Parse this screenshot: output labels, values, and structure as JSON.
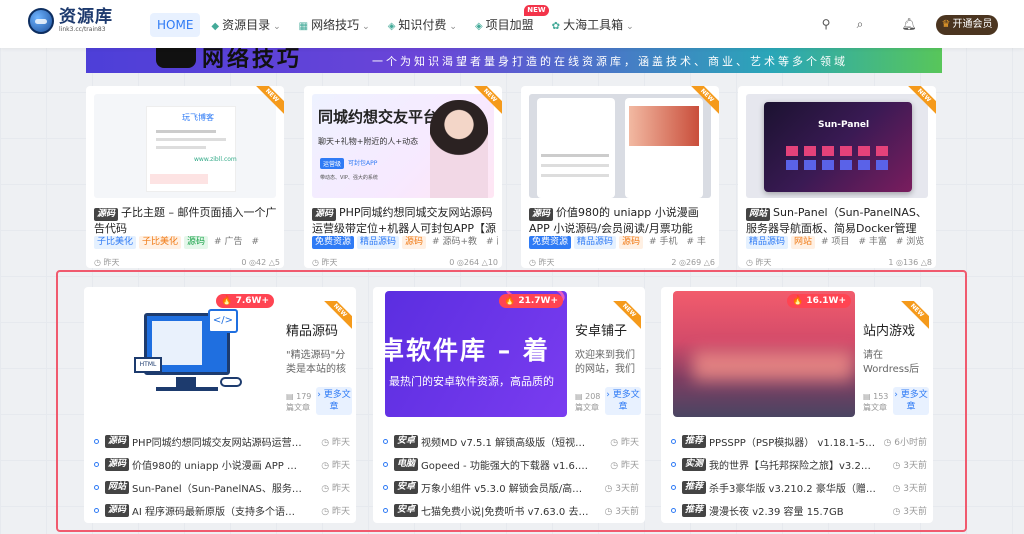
{
  "header": {
    "logo_title": "资源库",
    "logo_sub": "link3.cc/train83",
    "nav": [
      {
        "label": "HOME",
        "icon": "",
        "caret": false,
        "active": true
      },
      {
        "label": "资源目录",
        "icon": "◆",
        "caret": true
      },
      {
        "label": "网络技巧",
        "icon": "▦",
        "caret": true
      },
      {
        "label": "知识付费",
        "icon": "◈",
        "caret": true
      },
      {
        "label": "项目加盟",
        "icon": "◈",
        "caret": false,
        "badge": "NEW"
      },
      {
        "label": "大海工具箱",
        "icon": "✿",
        "caret": true
      }
    ],
    "vip_label": "开通会员"
  },
  "banner": {
    "title": "网络技巧",
    "slogan": "一个为知识渴望者量身打造的在线资源库，涵盖技术、商业、艺术等多个领域"
  },
  "top_cards": [
    {
      "new": "NEW",
      "cat": "源码",
      "title": "子比主题 – 邮件页面插入一个广告代码",
      "tags": [
        {
          "t": "子比美化",
          "c": "tg-blue"
        },
        {
          "t": "子比美化",
          "c": "tg-orange"
        },
        {
          "t": "源码",
          "c": "tg-green"
        },
        {
          "t": "# 广告",
          "c": "tg-grey"
        },
        {
          "t": "#",
          "c": "tg-grey"
        }
      ],
      "time": "昨天",
      "stats": "0 ◎42 △5",
      "thumb_brand": "玩飞博客",
      "thumb_url": "www.zibll.com"
    },
    {
      "new": "NEW",
      "cat": "源码",
      "title": "PHP同城约想同城交友网站源码运营级带定位+机器人可封包APP【源码+教",
      "tags": [
        {
          "t": "免费资源",
          "c": "tg-solid"
        },
        {
          "t": "精品源码",
          "c": "tg-blue"
        },
        {
          "t": "源码",
          "c": "tg-orange"
        },
        {
          "t": "# 源码+教",
          "c": "tg-grey"
        },
        {
          "t": "# 配",
          "c": "tg-grey"
        }
      ],
      "time": "昨天",
      "stats": "0 ◎264 △10",
      "thumb_title": "同城约想交友平台",
      "thumb_sub": "聊天+礼物+附近的人+动态",
      "thumb_tag1": "运营级",
      "thumb_tag2": "可封包APP",
      "thumb_tag3": "带动态、VIP、强大的系统"
    },
    {
      "new": "NEW",
      "cat": "源码",
      "title": "价值980的 uniapp 小说漫画 APP 小说源码/会员阅读/月票功能",
      "tags": [
        {
          "t": "免费资源",
          "c": "tg-solid"
        },
        {
          "t": "精品源码",
          "c": "tg-blue"
        },
        {
          "t": "源码",
          "c": "tg-orange"
        },
        {
          "t": "# 手机",
          "c": "tg-grey"
        },
        {
          "t": "# 丰",
          "c": "tg-grey"
        }
      ],
      "time": "昨天",
      "stats": "2 ◎269 △6"
    },
    {
      "new": "NEW",
      "cat": "网站",
      "title": "Sun-Panel（Sun-PanelNAS、服务器导航面板、简易Docker管理器、浏览器",
      "tags": [
        {
          "t": "精品源码",
          "c": "tg-blue"
        },
        {
          "t": "网站",
          "c": "tg-orange"
        },
        {
          "t": "# 项目",
          "c": "tg-grey"
        },
        {
          "t": "# 丰富",
          "c": "tg-grey"
        },
        {
          "t": "# 浏览",
          "c": "tg-grey"
        }
      ],
      "time": "昨天",
      "stats": "1 ◎136 △8",
      "thumb_title": "Sun-Panel"
    }
  ],
  "sections": [
    {
      "hot": "🔥 7.6W+",
      "name": "精品源码",
      "desc": "\"精选源码\"分类是本站的核心...",
      "count": "179 篇文章",
      "more": "更多文章",
      "items": [
        {
          "cat": "源码",
          "cat_color": "#444",
          "text": "PHP同城约想同城交友网站源码运营级...",
          "time": "昨天"
        },
        {
          "cat": "源码",
          "cat_color": "#444",
          "text": "价值980的 uniapp 小说漫画 APP 小说...",
          "time": "昨天"
        },
        {
          "cat": "网站",
          "cat_color": "#444",
          "text": "Sun-Panel（Sun-PanelNAS、服务器导...",
          "time": "昨天"
        },
        {
          "cat": "源码",
          "cat_color": "#444",
          "text": "AI 程序源码最新原版（支持多个语言）",
          "time": "昨天"
        }
      ]
    },
    {
      "hot": "🔥 21.7W+",
      "name": "安卓铺子",
      "desc": "欢迎来到我们的网站，我们致...",
      "count": "208 篇文章",
      "more": "更多文章",
      "img_title": "卓软件库 – 着",
      "img_sub": "最热门的安卓软件资源，高品质的",
      "items": [
        {
          "cat": "安卓",
          "cat_color": "#444",
          "text": "视频MD v7.5.1 解锁高级版（短视频处...",
          "time": "昨天"
        },
        {
          "cat": "电脑",
          "cat_color": "#444",
          "text": "Gopeed - 功能强大的下载器 v1.6.5 中...",
          "time": "昨天"
        },
        {
          "cat": "安卓",
          "cat_color": "#444",
          "text": "万象小组件 v5.3.0 解锁会员版/高级版...",
          "time": "3天前"
        },
        {
          "cat": "安卓",
          "cat_color": "#444",
          "text": "七猫免费小说|免费听书 v7.63.0 去广...",
          "time": "3天前"
        }
      ]
    },
    {
      "hot": "🔥 16.1W+",
      "name": "站内游戏",
      "desc": "请在Wordress后台-文章-文...",
      "count": "153 篇文章",
      "more": "更多文章",
      "items": [
        {
          "cat": "推荐",
          "cat_color": "#444",
          "text": "PPSSPP（PSP模拟器） v1.18.1-549 ...",
          "time": "6小时前"
        },
        {
          "cat": "实测",
          "cat_color": "#444",
          "text": "我的世界【乌托邦探险之旅】v3.2大型...",
          "time": "3天前"
        },
        {
          "cat": "推荐",
          "cat_color": "#444",
          "text": "杀手3豪华版 v3.210.2 豪华版（赠多项...",
          "time": "3天前"
        },
        {
          "cat": "推荐",
          "cat_color": "#444",
          "text": "漫漫长夜 v2.39 容量 15.7GB",
          "time": "3天前"
        }
      ]
    }
  ]
}
